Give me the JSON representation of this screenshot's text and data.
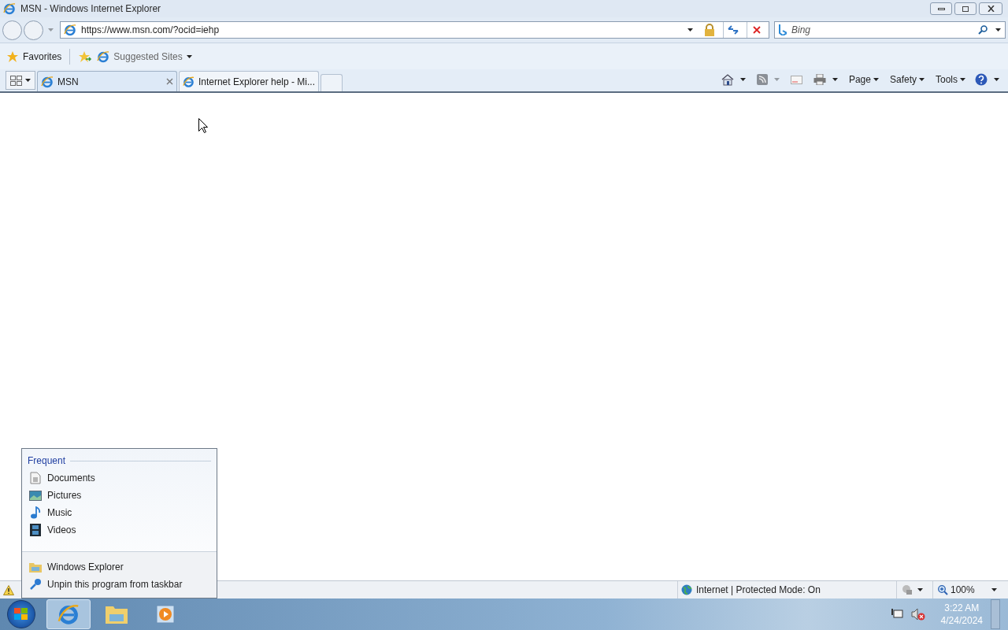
{
  "window": {
    "title": "MSN - Windows Internet Explorer"
  },
  "address": {
    "value": "https://www.msn.com/?ocid=iehp"
  },
  "search": {
    "placeholder": "Bing"
  },
  "favorites_bar": {
    "favorites": "Favorites",
    "suggested": "Suggested Sites"
  },
  "tabs": [
    {
      "label": "MSN",
      "selected": true
    },
    {
      "label": "Internet Explorer help - Mi...",
      "selected": false
    }
  ],
  "command_bar": [
    "Page",
    "Safety",
    "Tools"
  ],
  "jump_list": {
    "heading": "Frequent",
    "items": [
      {
        "label": "Documents",
        "kind": "documents"
      },
      {
        "label": "Pictures",
        "kind": "pictures"
      },
      {
        "label": "Music",
        "kind": "music"
      },
      {
        "label": "Videos",
        "kind": "videos"
      }
    ],
    "tasks": [
      {
        "label": "Windows Explorer",
        "kind": "explorer"
      },
      {
        "label": "Unpin this program from taskbar",
        "kind": "unpin"
      }
    ]
  },
  "status_bar": {
    "zone": "Internet | Protected Mode: On",
    "zoom": "100%"
  },
  "taskbar": {
    "time": "3:22 AM",
    "date": "4/24/2024"
  }
}
